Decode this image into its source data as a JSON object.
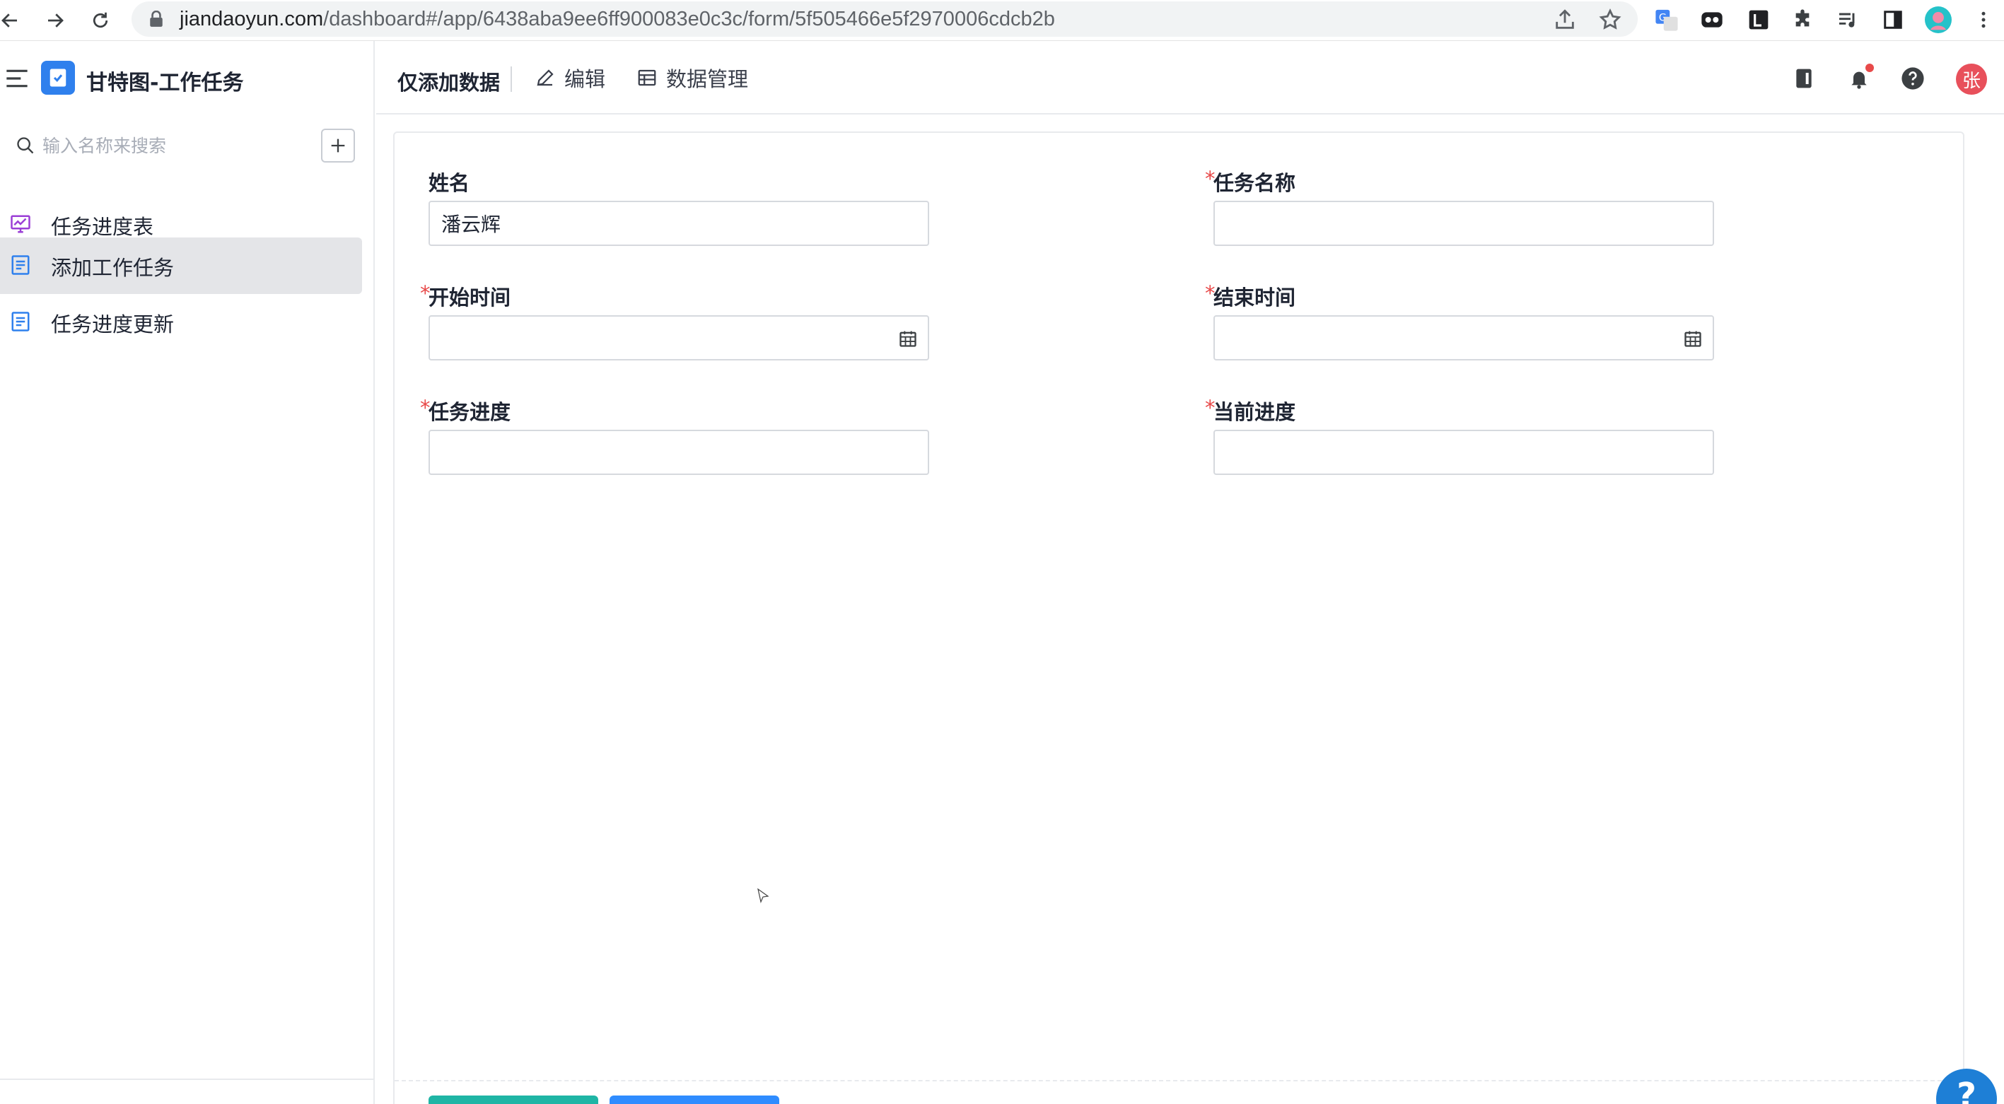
{
  "browser": {
    "url_host": "jiandaoyun.com",
    "url_path": "/dashboard#/app/6438aba9ee6ff900083e0c3c/form/5f505466e5f2970006cdcb2b"
  },
  "sidebar": {
    "app_title": "甘特图-工作任务",
    "search_placeholder": "输入名称来搜索",
    "items": [
      {
        "label": "任务进度表",
        "icon": "dashboard-chart-icon",
        "active": false
      },
      {
        "label": "添加工作任务",
        "icon": "form-document-icon",
        "active": true
      },
      {
        "label": "任务进度更新",
        "icon": "form-document-icon",
        "active": false
      }
    ]
  },
  "header": {
    "mode_title": "仅添加数据",
    "edit_label": "编辑",
    "data_manage_label": "数据管理",
    "avatar_text": "张"
  },
  "form": {
    "fields": [
      {
        "label": "姓名",
        "required": false,
        "value": "潘云辉",
        "type": "text"
      },
      {
        "label": "任务名称",
        "required": true,
        "value": "",
        "type": "text"
      },
      {
        "label": "开始时间",
        "required": true,
        "value": "",
        "type": "date"
      },
      {
        "label": "结束时间",
        "required": true,
        "value": "",
        "type": "date"
      },
      {
        "label": "任务进度",
        "required": true,
        "value": "",
        "type": "text"
      },
      {
        "label": "当前进度",
        "required": true,
        "value": "",
        "type": "text"
      }
    ],
    "required_mark": "*"
  },
  "help_fab": "?",
  "colors": {
    "accent": "#2f80ed",
    "required": "#e84a4a",
    "submit_teal": "#1fb5a5",
    "submit_blue": "#2f8cff",
    "active_bg": "#e4e5e8"
  }
}
